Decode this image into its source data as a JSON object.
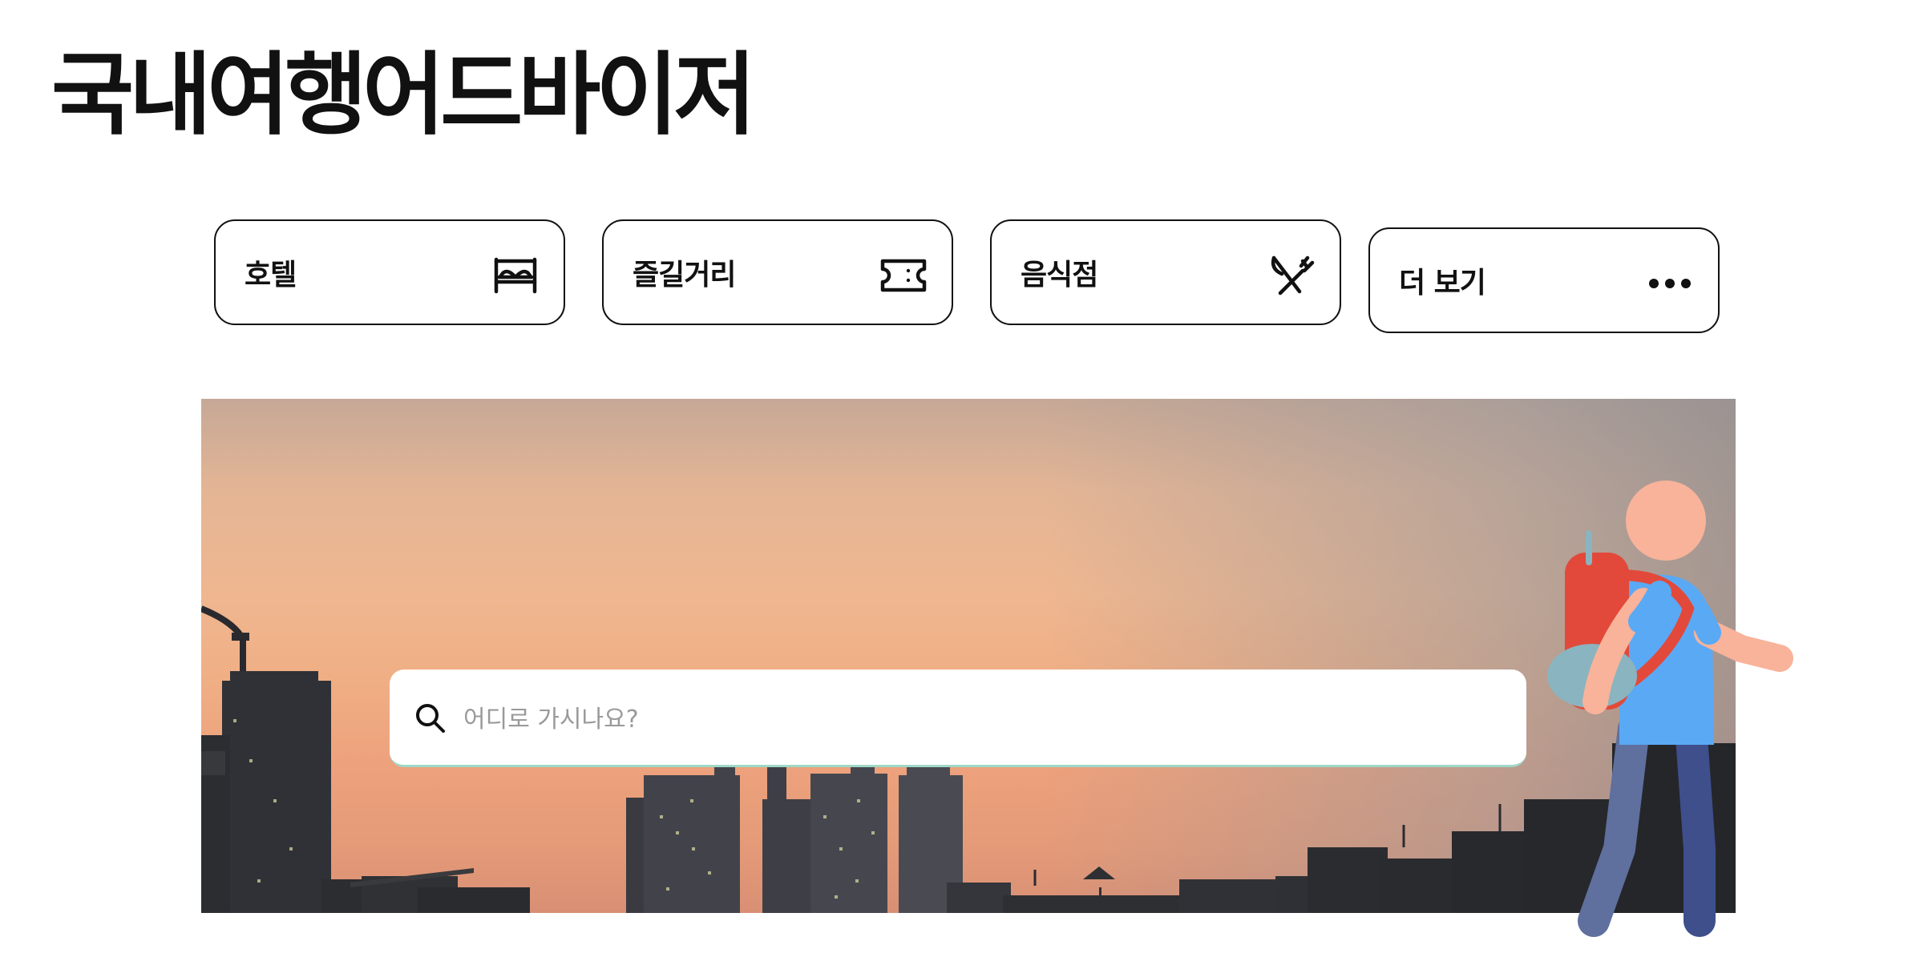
{
  "app": {
    "title": "국내여행어드바이저"
  },
  "categories": [
    {
      "label": "호텔",
      "icon": "bed-icon"
    },
    {
      "label": "즐길거리",
      "icon": "ticket-icon"
    },
    {
      "label": "음식점",
      "icon": "fork-knife-icon"
    },
    {
      "label": "더 보기",
      "icon": "more-dots-icon"
    }
  ],
  "search": {
    "placeholder": "어디로 가시나요?",
    "value": ""
  },
  "hero": {
    "image": "sunset-city-skyline",
    "illustration": "backpacker-traveler"
  },
  "colors": {
    "text": "#111111",
    "placeholder": "#9a9a9a",
    "backpack": "#e2493a",
    "shirt": "#5aa9f5",
    "skin": "#f8b39a",
    "pants_front": "#3f4f8c",
    "pants_back": "#5f6f9e"
  }
}
